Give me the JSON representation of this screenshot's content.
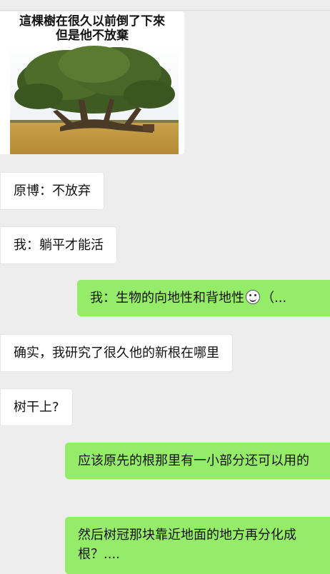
{
  "image_message": {
    "caption_line1": "這棵樹在很久以前倒了下來",
    "caption_line2": "但是他不放棄"
  },
  "messages": [
    {
      "side": "left",
      "text": "原博：不放弃"
    },
    {
      "side": "left",
      "text": "我：躺平才能活"
    },
    {
      "side": "right",
      "text_before": "我：生物的向地性和背地性",
      "emoji": "thinking-face-emoji",
      "text_after": "（..."
    },
    {
      "side": "left",
      "text": "确实，我研究了很久他的新根在哪里"
    },
    {
      "side": "left",
      "text": "树干上?"
    },
    {
      "side": "right",
      "text": "应该原先的根那里有一小部分还可以用的"
    },
    {
      "side": "right",
      "text": "然后树冠那块靠近地面的地方再分化成根？...."
    }
  ],
  "colors": {
    "background": "#ededed",
    "incoming_bubble": "#ffffff",
    "outgoing_bubble": "#95ec69"
  }
}
